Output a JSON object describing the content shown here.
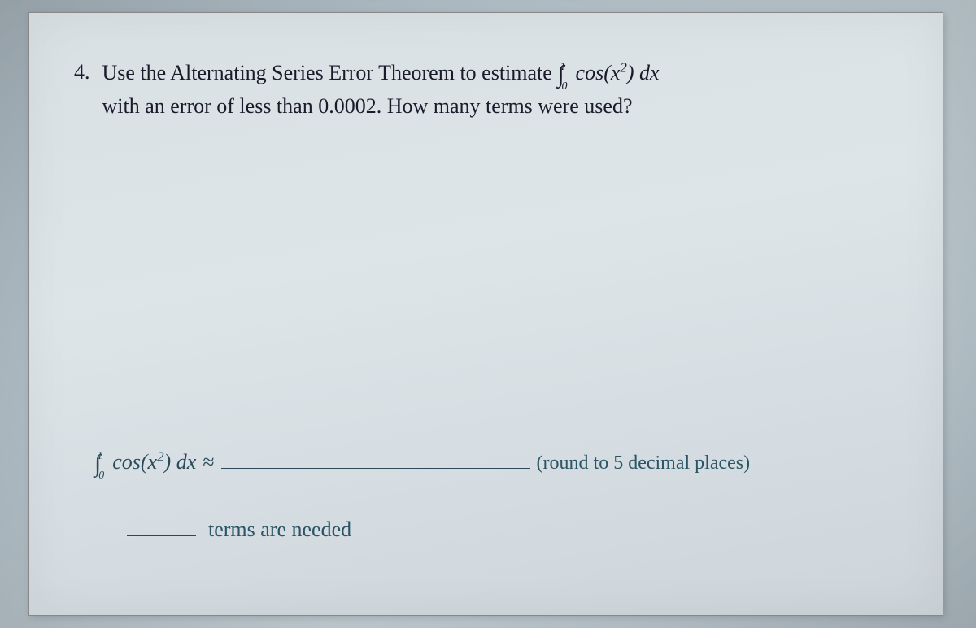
{
  "question": {
    "number": "4.",
    "text_part1": "Use the Alternating Series Error Theorem to estimate ",
    "text_part2": "with an error of less than 0.0002.  How many terms were used?",
    "integral_lower": "0",
    "integral_upper": "1",
    "integrand_prefix": "cos(",
    "integrand_var": "x",
    "integrand_exp": "2",
    "integrand_suffix": ") ",
    "differential": "dx"
  },
  "answers": {
    "integral_lower": "0",
    "integral_upper": "1",
    "integrand_prefix": "cos(",
    "integrand_var": "x",
    "integrand_exp": "2",
    "integrand_suffix": ") ",
    "differential": "dx",
    "approx_symbol": "≈",
    "round_note": "(round to 5 decimal places)",
    "terms_text": "terms are needed"
  }
}
